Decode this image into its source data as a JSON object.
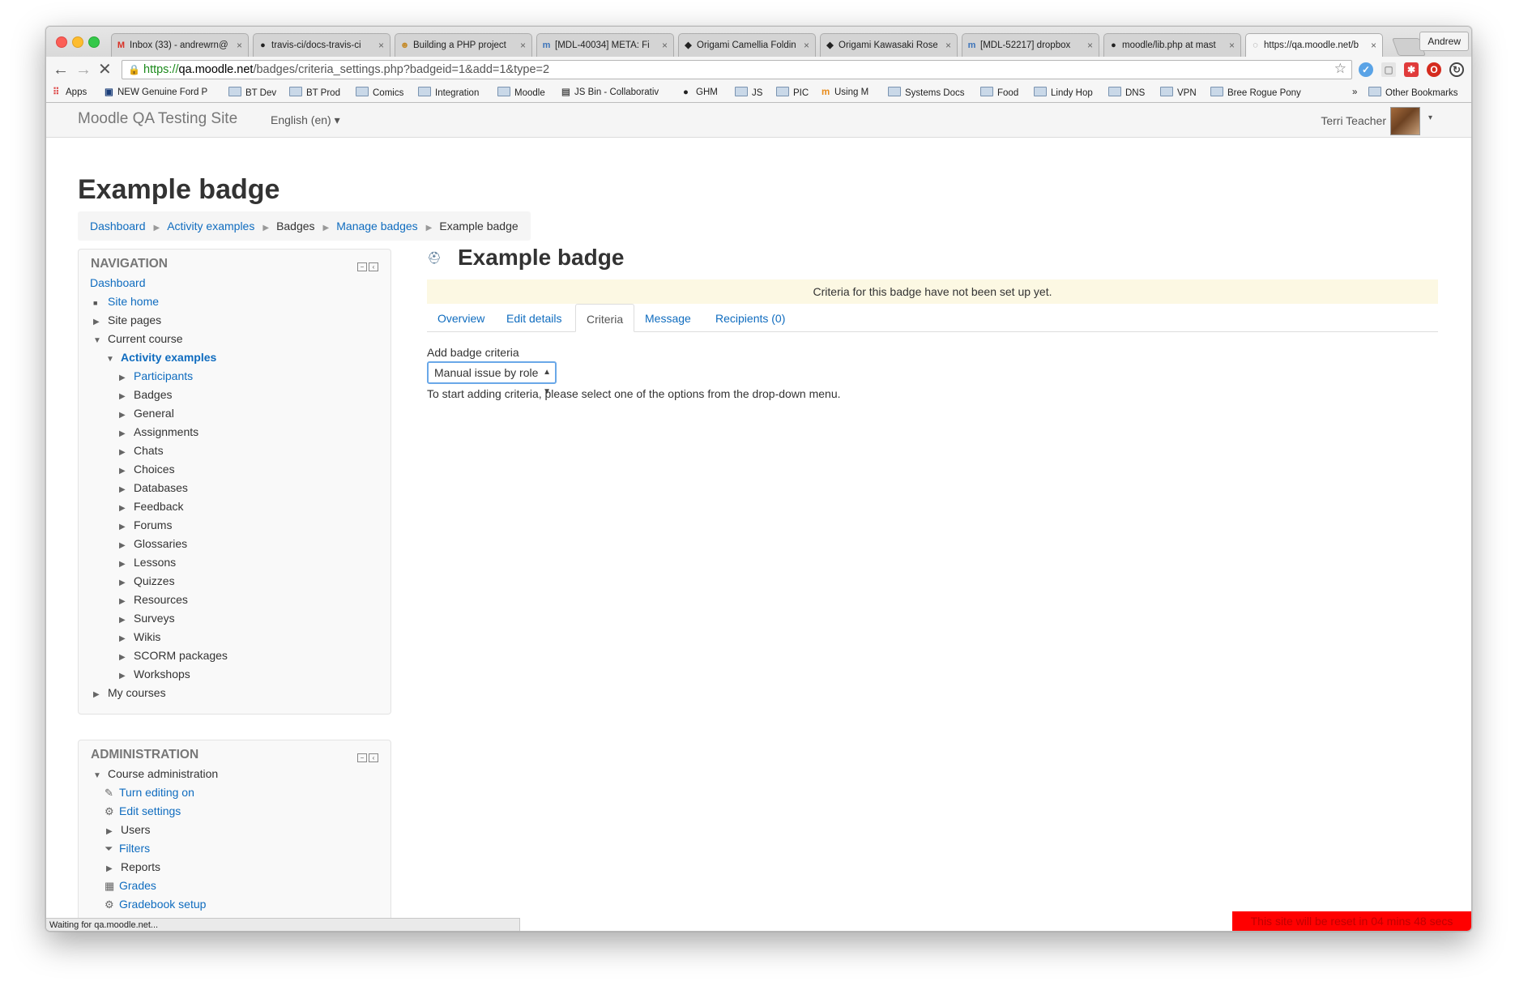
{
  "browser": {
    "tabs": [
      {
        "label": "Inbox (33) - andrewrn@",
        "favicon": "M",
        "favicon_color": "#d93025"
      },
      {
        "label": "travis-ci/docs-travis-ci",
        "favicon": "●",
        "favicon_color": "#111111"
      },
      {
        "label": "Building a PHP project",
        "favicon": "☻",
        "favicon_color": "#c58b2a"
      },
      {
        "label": "[MDL-40034] META: Fi",
        "favicon": "m",
        "favicon_color": "#3b73b9"
      },
      {
        "label": "Origami Camellia Foldin",
        "favicon": "◆",
        "favicon_color": "#111111"
      },
      {
        "label": "Origami Kawasaki Rose",
        "favicon": "◆",
        "favicon_color": "#111111"
      },
      {
        "label": "[MDL-52217] dropbox",
        "favicon": "m",
        "favicon_color": "#3b73b9"
      },
      {
        "label": "moodle/lib.php at mast",
        "favicon": "●",
        "favicon_color": "#111111"
      },
      {
        "label": "https://qa.moodle.net/b",
        "favicon": "◌",
        "favicon_color": "#777777"
      }
    ],
    "profile": "Andrew",
    "url": {
      "scheme": "https://",
      "host": "qa.moodle.net",
      "path": "/badges/criteria_settings.php?badgeid=1&add=1&type=2"
    },
    "bookmarks": [
      {
        "label": "Apps",
        "icon": "apps-icon"
      },
      {
        "label": "NEW Genuine Ford P",
        "icon": "site-icon"
      },
      {
        "label": "BT Dev",
        "icon": "folder-icon"
      },
      {
        "label": "BT Prod",
        "icon": "folder-icon"
      },
      {
        "label": "Comics",
        "icon": "folder-icon"
      },
      {
        "label": "Integration",
        "icon": "folder-icon"
      },
      {
        "label": "Moodle",
        "icon": "folder-icon"
      },
      {
        "label": "JS Bin - Collaborativ",
        "icon": "site-icon"
      },
      {
        "label": "GHM",
        "icon": "github-icon"
      },
      {
        "label": "JS",
        "icon": "folder-icon"
      },
      {
        "label": "PIC",
        "icon": "folder-icon"
      },
      {
        "label": "Using M",
        "icon": "moodle-icon"
      },
      {
        "label": "Systems Docs",
        "icon": "folder-icon"
      },
      {
        "label": "Food",
        "icon": "folder-icon"
      },
      {
        "label": "Lindy Hop",
        "icon": "folder-icon"
      },
      {
        "label": "DNS",
        "icon": "folder-icon"
      },
      {
        "label": "VPN",
        "icon": "folder-icon"
      },
      {
        "label": "Bree Rogue Pony",
        "icon": "folder-icon"
      }
    ],
    "bookmarks_overflow": "»",
    "other_bookmarks": "Other Bookmarks",
    "status": "Waiting for qa.moodle.net..."
  },
  "header": {
    "site_name": "Moodle QA Testing Site",
    "language": "English (en) ▾",
    "user_name": "Terri Teacher",
    "user_caret": "▾"
  },
  "page_title": "Example badge",
  "breadcrumb": [
    "Dashboard",
    "Activity examples",
    "Badges",
    "Manage badges",
    "Example badge"
  ],
  "navigation": {
    "title": "NAVIGATION",
    "items": [
      "Dashboard",
      "Site home",
      "Site pages",
      "Current course",
      "Activity examples",
      "Participants",
      "Badges",
      "General",
      "Assignments",
      "Chats",
      "Choices",
      "Databases",
      "Feedback",
      "Forums",
      "Glossaries",
      "Lessons",
      "Quizzes",
      "Resources",
      "Surveys",
      "Wikis",
      "SCORM packages",
      "Workshops",
      "My courses"
    ]
  },
  "administration": {
    "title": "ADMINISTRATION",
    "items": [
      "Course administration",
      "Turn editing on",
      "Edit settings",
      "Users",
      "Filters",
      "Reports",
      "Grades",
      "Gradebook setup"
    ]
  },
  "main": {
    "heading": "Example badge",
    "alert": "Criteria for this badge have not been set up yet.",
    "tabs": [
      "Overview",
      "Edit details",
      "Criteria",
      "Message",
      "Recipients (0)"
    ],
    "active_tab": "Criteria",
    "add_label": "Add badge criteria",
    "select_value": "Manual issue by role",
    "help": "To start adding criteria, please select one of the options from the drop-down menu."
  },
  "reset_notice": "This site will be reset in 04 mins 48 secs",
  "colors": {
    "link": "#0f6cbf",
    "alert_bg": "#fcf8e3",
    "reset_bg": "#ff0000"
  }
}
